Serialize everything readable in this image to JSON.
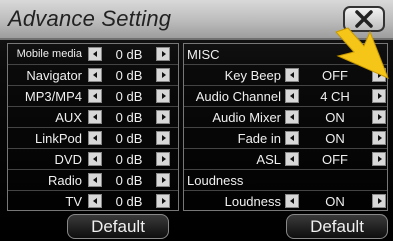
{
  "header": {
    "title": "Advance Setting",
    "close_icon": "close-icon"
  },
  "left_panel": {
    "rows": [
      {
        "label": "Mobile media",
        "value": "0 dB"
      },
      {
        "label": "Navigator",
        "value": "0 dB"
      },
      {
        "label": "MP3/MP4",
        "value": "0 dB"
      },
      {
        "label": "AUX",
        "value": "0 dB"
      },
      {
        "label": "LinkPod",
        "value": "0 dB"
      },
      {
        "label": "DVD",
        "value": "0 dB"
      },
      {
        "label": "Radio",
        "value": "0 dB"
      },
      {
        "label": "TV",
        "value": "0 dB"
      }
    ],
    "default_label": "Default"
  },
  "right_panel": {
    "misc_header": "MISC",
    "rows": [
      {
        "label": "Key Beep",
        "value": "OFF"
      },
      {
        "label": "Audio Channel",
        "value": "4 CH"
      },
      {
        "label": "Audio Mixer",
        "value": "ON"
      },
      {
        "label": "Fade in",
        "value": "ON"
      },
      {
        "label": "ASL",
        "value": "OFF"
      }
    ],
    "loudness_header": "Loudness",
    "loudness_row": {
      "label": "Loudness",
      "value": "ON"
    },
    "default_label": "Default"
  },
  "colors": {
    "accent_arrow": "#f5c518",
    "title_bar": "#c8c8c8"
  }
}
